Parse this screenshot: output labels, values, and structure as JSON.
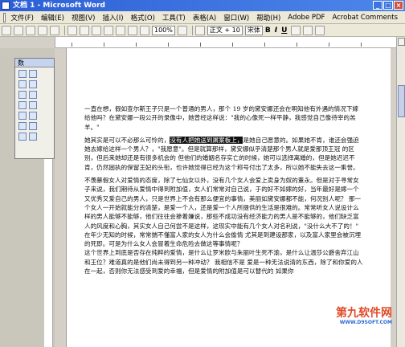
{
  "window": {
    "title": "文档 1 - Microsoft Word"
  },
  "menu": [
    "文件(F)",
    "编辑(E)",
    "视图(V)",
    "插入(I)",
    "格式(O)",
    "工具(T)",
    "表格(A)",
    "窗口(W)",
    "帮助(H)",
    "Adobe PDF",
    "Acrobat Comments"
  ],
  "toolbar": {
    "zoom": "100%",
    "style": "正文 + 10",
    "font": "宋体",
    "bold": "B",
    "italic": "I",
    "underline": "U"
  },
  "panel": {
    "title": "数"
  },
  "document": {
    "p1": "一直在想，假如查尔斯王子只是一个普通的男人，那个 19 岁的黛安娜还会在明知他有外遇的情况下嫁给他吗？在黛安娜一段公开的录像中，她曾经这样说：\"我的心像死一样平静，我感觉自己像待宰的羔羊。\"",
    "p2_pre": "她其实是可以不必那么可怜的，",
    "p2_hl": "没有人把她送到屠案板上，",
    "p2_post": "是她自己愿意的。如果她不肯，谁还会强迫她去嫁给这样一个男人？，\"我愿意\"。但是就算那样，黛安娜似乎清楚那个男人就是爱那顶王冠 的区别，但后来她却还是有很多机会的 但他们的婚姻名存实亡的时候，她可以选择离婚的，但是她迟迟不肯，仍然固执的保留王妃的头衔，也许她觉得已经为这个称号付出了太多，所以她不能失去这一乘誉。",
    "p3": "不羡慕假女人对爱情的态度，除了七仙女以外，没有几个女人会爱上卖身为奴的董永。但是对于寻常女子来说，我们期待从爱情中得到附加值，女人们常常对自己说，于的好不如嫁的好，当年最好是嫁一个又优秀又爱自己的男人，只是世界上不会有那么便宜的事情，美丽如黛安娜都不能，何况别人呢？ 那一个女人一开始就能分的清楚，是爱一个人，还是爱一个人所提供的生活是很难的。常常听女人说设计么样的男人能够不能够，他们往往会掺着嫌说，那些不成功没有经济能力的男人是不能够的，他们缺乏富人的风度和心胸，其实女人自己何尝不是这样，这现实中能有几个女人对名利说，\"没什么大不了的！\"",
    "p4": "在年少无知的时候，常常揣不懂富人家的女人为什么会偷情 尤其是到建设那家，以及富人家里会被沉埋的死即。可是为什么女人会冒着生命危险去做这等事情呢？",
    "p5": "这个世界上到底是否存在纯粹的爱情，是什么让罗米欧与朱丽叶生死不渝，是什么让温莎公爵舍弃江山和王位？难道真的是他们尚未得到另一种冲动？ 我相信不是 爱是一种无法说清的东西，除了和你爱的人在一起，否则你无法感受到爱的幸福，但是爱情的附加值是可以替代的 如果你"
  },
  "watermark": {
    "text": "第九软件网",
    "url": "WWW.D9SOFT.COM"
  }
}
